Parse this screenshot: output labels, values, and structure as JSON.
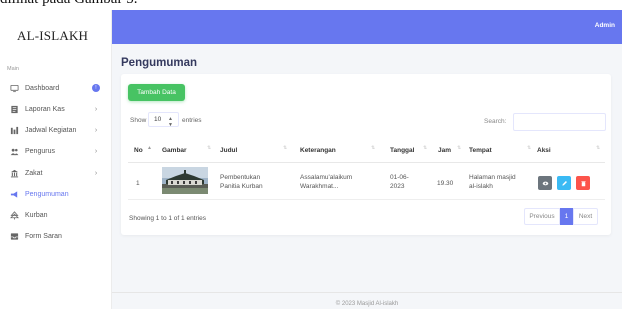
{
  "caption": "dilihat pada Gambar 5.",
  "brand": "AL-ISLAKH",
  "sidebar": {
    "header": "Main",
    "items": [
      {
        "label": "Dashboard",
        "icon": "monitor-icon",
        "badge": ""
      },
      {
        "label": "Laporan Kas",
        "icon": "list-icon",
        "chevron": "›"
      },
      {
        "label": "Jadwal Kegiatan",
        "icon": "grid-icon",
        "chevron": "›"
      },
      {
        "label": "Pengurus",
        "icon": "users-icon",
        "chevron": "›"
      },
      {
        "label": "Zakat",
        "icon": "building-icon",
        "chevron": "›"
      },
      {
        "label": "Pengumuman",
        "icon": "megaphone-icon"
      },
      {
        "label": "Kurban",
        "icon": "tree-icon"
      },
      {
        "label": "Form Saran",
        "icon": "inbox-icon"
      }
    ]
  },
  "topbar": {
    "user": "Admin"
  },
  "page": {
    "title": "Pengumuman"
  },
  "toolbar": {
    "add_label": "Tambah Data"
  },
  "table_controls": {
    "show": "Show",
    "page_size": "10",
    "entries": "entries",
    "search_label": "Search:"
  },
  "table": {
    "headers": [
      "No",
      "Gambar",
      "Judul",
      "Keterangan",
      "Tanggal",
      "Jam",
      "Tempat",
      "Aksi"
    ],
    "rows": [
      {
        "no": "1",
        "judul_1": "Pembentukan",
        "judul_2": "Panitia Kurban",
        "keterangan_1": "Assalamu'alaikum",
        "keterangan_2": "Warakhmat...",
        "tanggal_1": "01-06-",
        "tanggal_2": "2023",
        "jam": "19.30",
        "tempat_1": "Halaman masjid",
        "tempat_2": "al-islakh"
      }
    ]
  },
  "pagination": {
    "info": "Showing 1 to 1 of 1 entries",
    "prev": "Previous",
    "current": "1",
    "next": "Next"
  },
  "footer": {
    "text": "© 2023 Masjid Al-islakh"
  },
  "colors": {
    "primary": "#6777ef",
    "success": "#47c363",
    "view": "#6c757d",
    "edit": "#3abaf4",
    "delete": "#fc544b"
  }
}
